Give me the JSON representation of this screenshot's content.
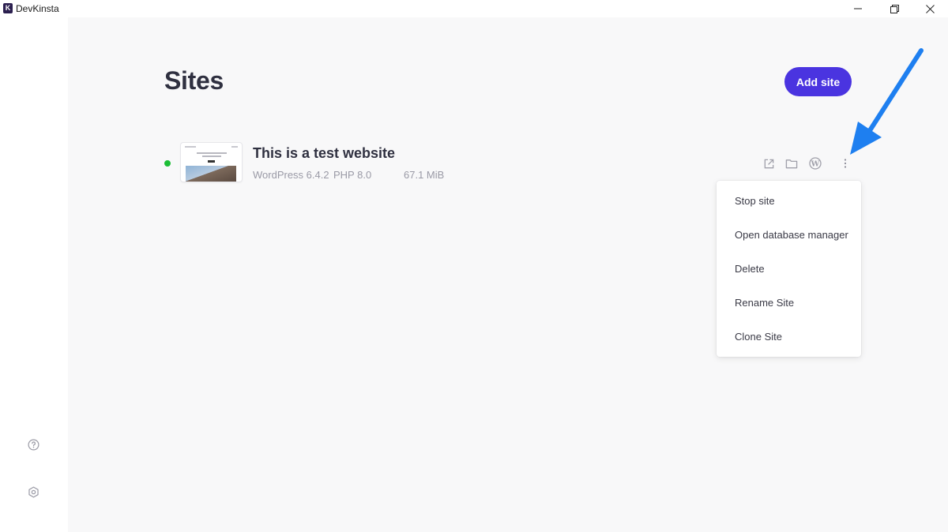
{
  "window": {
    "logo_letter": "K",
    "title": "DevKinsta"
  },
  "main": {
    "page_title": "Sites",
    "add_site_label": "Add site"
  },
  "site": {
    "name": "This is a test website",
    "wordpress": "WordPress 6.4.2",
    "php": "PHP 8.0",
    "size": "67.1 MiB",
    "status_color": "#1cbe36"
  },
  "menu": {
    "items": [
      {
        "label": "Stop site"
      },
      {
        "label": "Open database manager"
      },
      {
        "label": "Delete"
      },
      {
        "label": "Rename Site"
      },
      {
        "label": "Clone Site"
      }
    ]
  },
  "icons": {
    "titlebar": [
      "minimize-icon",
      "maximize-icon",
      "close-icon"
    ],
    "sidebar": [
      "help-icon",
      "settings-gear-icon"
    ],
    "site_actions": [
      "external-link-icon",
      "folder-icon",
      "wordpress-icon",
      "more-vertical-icon"
    ]
  },
  "colors": {
    "accent": "#4a34e0",
    "annotation_arrow": "#1e7ff0"
  }
}
